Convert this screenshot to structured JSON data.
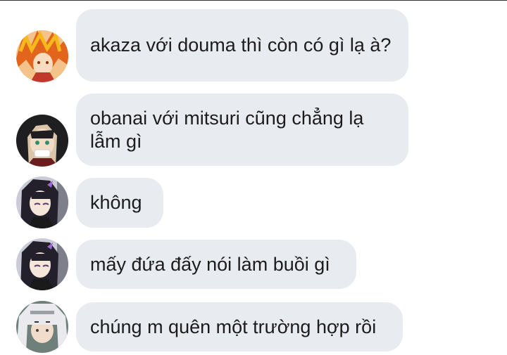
{
  "messages": [
    {
      "avatar": "fire-hair-character-avatar",
      "text": "akaza với douma thì còn có gì lạ à?"
    },
    {
      "avatar": "dark-hair-bandaged-character-avatar",
      "text": "obanai với mitsuri cũng chẳng lạ lẫm gì"
    },
    {
      "avatar": "butterfly-hair-character-avatar",
      "text": "không"
    },
    {
      "avatar": "butterfly-hair-character-avatar",
      "text": "mấy đứa đấy nói làm buồi gì"
    },
    {
      "avatar": "white-hair-character-avatar",
      "text": "chúng m quên một trường hợp rồi"
    }
  ],
  "colors": {
    "bubble_bg": "#e8ebf0",
    "text": "#1c1c1c"
  }
}
